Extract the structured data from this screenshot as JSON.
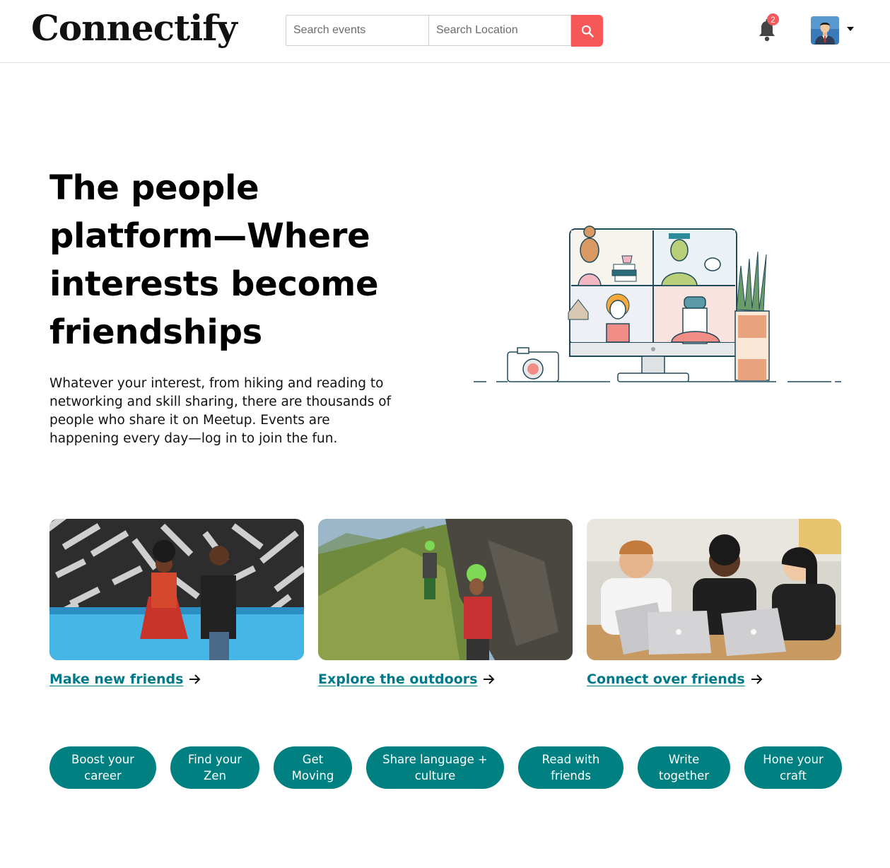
{
  "header": {
    "logo": "Connectify",
    "search_events_placeholder": "Search events",
    "search_location_placeholder": "Search Location",
    "notification_count": "2",
    "icons": {
      "search": "search-icon",
      "bell": "bell-icon",
      "avatar": "user-avatar",
      "caret": "caret-down-icon"
    }
  },
  "hero": {
    "title": "The people platform—Where interests become friendships",
    "description": "Whatever your interest, from hiking and reading to networking and skill sharing, there are thousands of people who share it on Meetup. Events are happening every day—log in to join the fun."
  },
  "cards": [
    {
      "label": "Make new friends",
      "image": "friends-photo"
    },
    {
      "label": "Explore the outdoors",
      "image": "outdoors-photo"
    },
    {
      "label": "Connect over friends",
      "image": "laptops-photo"
    }
  ],
  "categories": [
    {
      "line1": "Boost your",
      "line2": "career"
    },
    {
      "line1": "Find your",
      "line2": "Zen"
    },
    {
      "line1": "Get",
      "line2": "Moving"
    },
    {
      "line1": "Share language +",
      "line2": "culture"
    },
    {
      "line1": "Read with",
      "line2": "friends"
    },
    {
      "line1": "Write",
      "line2": "together"
    },
    {
      "line1": "Hone your",
      "line2": "craft"
    }
  ],
  "colors": {
    "accent": "#f65858",
    "teal": "#008080",
    "link": "#00798a"
  }
}
